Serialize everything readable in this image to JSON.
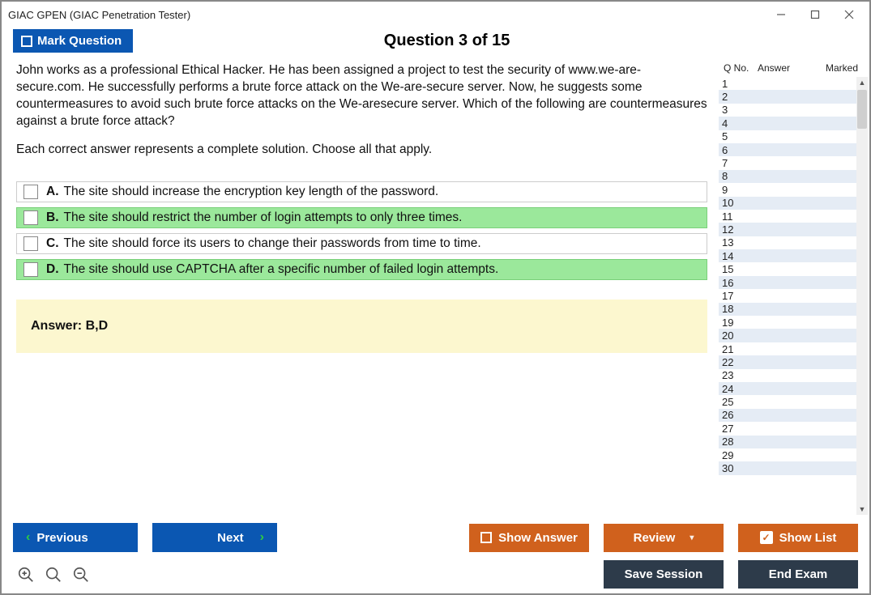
{
  "title": "GIAC GPEN (GIAC Penetration Tester)",
  "header": {
    "mark_label": "Mark Question",
    "question_count": "Question 3 of 15"
  },
  "question": {
    "para1": "John works as a professional Ethical Hacker. He has been assigned a project to test the security of www.we-are-secure.com. He successfully performs a brute force attack on the We-are-secure server. Now, he suggests some countermeasures to avoid such brute force attacks on the We-aresecure server. Which of the following are countermeasures against a brute force attack?",
    "para2": "Each correct answer represents a complete solution. Choose all that apply."
  },
  "options": [
    {
      "label": "A.",
      "text": "The site should increase the encryption key length of the password.",
      "correct": false
    },
    {
      "label": "B.",
      "text": "The site should restrict the number of login attempts to only three times.",
      "correct": true
    },
    {
      "label": "C.",
      "text": "The site should force its users to change their passwords from time to time.",
      "correct": false
    },
    {
      "label": "D.",
      "text": "The site should use CAPTCHA after a specific number of failed login attempts.",
      "correct": true
    }
  ],
  "answer_text": "Answer: B,D",
  "list": {
    "headers": {
      "qno": "Q No.",
      "answer": "Answer",
      "marked": "Marked"
    },
    "count": 30
  },
  "buttons": {
    "previous": "Previous",
    "next": "Next",
    "show_answer": "Show Answer",
    "review": "Review",
    "show_list": "Show List",
    "save_session": "Save Session",
    "end_exam": "End Exam"
  }
}
